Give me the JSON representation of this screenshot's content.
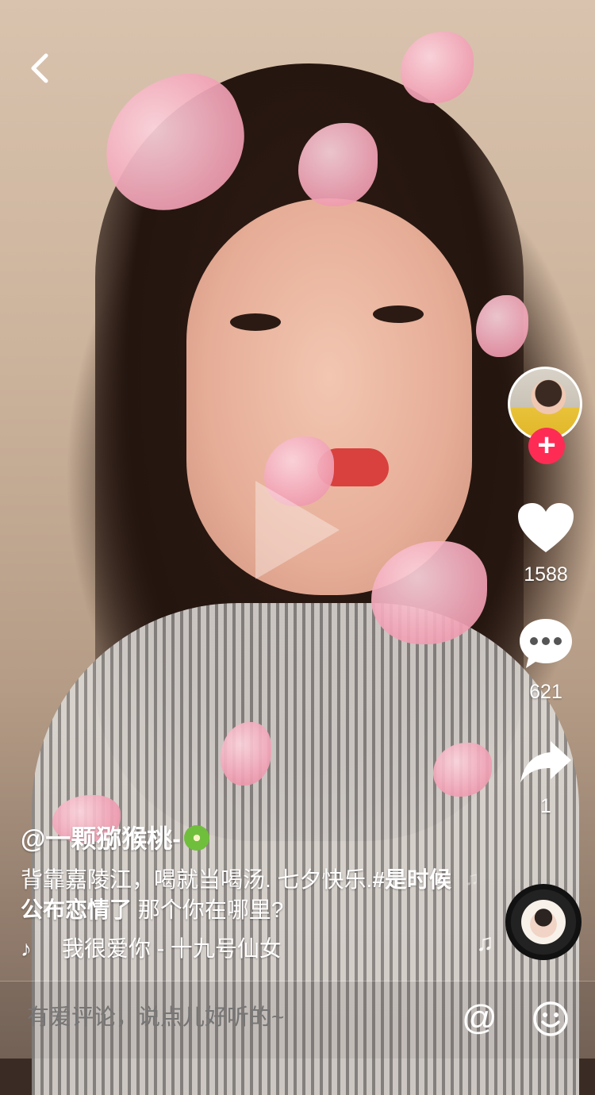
{
  "video": {
    "play_icon": "play-icon"
  },
  "nav": {
    "back_icon": "chevron-left-icon"
  },
  "sidebar": {
    "avatar_icon": "creator-avatar",
    "follow_label": "+",
    "like_count": "1588",
    "comment_count": "621",
    "share_count": "1"
  },
  "post": {
    "username": "@一颗猕猴桃-",
    "username_emoji": "kiwi-icon",
    "caption_text": "背靠嘉陵江，喝就当喝汤. 七夕快乐.",
    "hashtag": "#是时候公布恋情了",
    "caption_tail": "  那个你在哪里?",
    "music_icon": "tiktok-note-icon",
    "music_title": "我很爱你 - 十九号仙女"
  },
  "comment_bar": {
    "placeholder": "有爱评论，说点儿好听的~",
    "at_label": "@",
    "emoji_icon": "smiley-icon"
  },
  "colors": {
    "accent": "#fe2c55",
    "text": "#ffffff"
  }
}
